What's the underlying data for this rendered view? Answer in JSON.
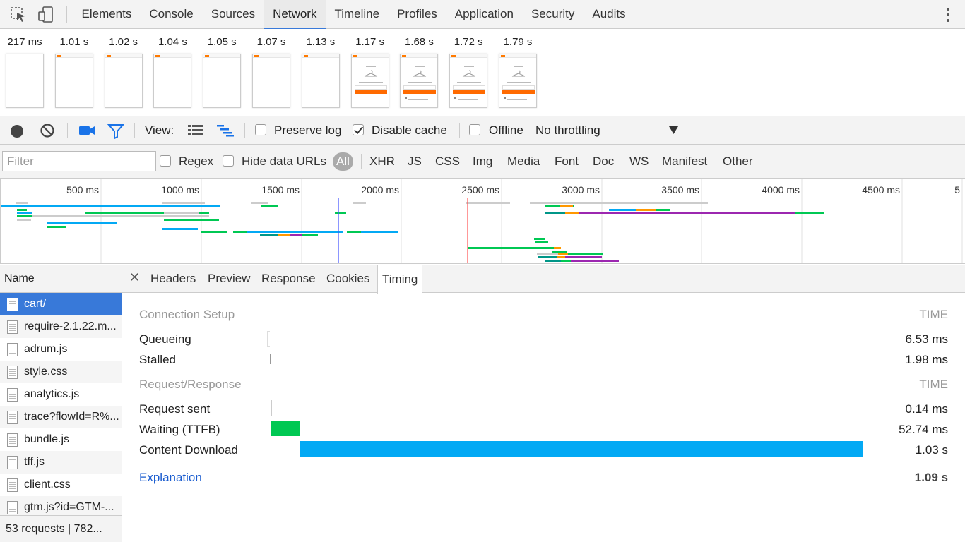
{
  "top_tabs": [
    "Elements",
    "Console",
    "Sources",
    "Network",
    "Timeline",
    "Profiles",
    "Application",
    "Security",
    "Audits"
  ],
  "active_tab": "Network",
  "filmstrip": {
    "frames": [
      {
        "time": "217 ms",
        "content": "blank"
      },
      {
        "time": "1.01 s",
        "content": "header"
      },
      {
        "time": "1.02 s",
        "content": "header"
      },
      {
        "time": "1.04 s",
        "content": "header"
      },
      {
        "time": "1.05 s",
        "content": "header"
      },
      {
        "time": "1.07 s",
        "content": "header"
      },
      {
        "time": "1.13 s",
        "content": "header"
      },
      {
        "time": "1.17 s",
        "content": "cart"
      },
      {
        "time": "1.68 s",
        "content": "cart-full"
      },
      {
        "time": "1.72 s",
        "content": "cart-full"
      },
      {
        "time": "1.79 s",
        "content": "cart-full"
      }
    ]
  },
  "toolbar": {
    "view_label": "View:",
    "preserve_log_label": "Preserve log",
    "preserve_log_checked": false,
    "disable_cache_label": "Disable cache",
    "disable_cache_checked": true,
    "offline_label": "Offline",
    "offline_checked": false,
    "throttling_value": "No throttling"
  },
  "filterbar": {
    "filter_placeholder": "Filter",
    "regex_label": "Regex",
    "hide_data_urls_label": "Hide data URLs",
    "types": [
      "All",
      "XHR",
      "JS",
      "CSS",
      "Img",
      "Media",
      "Font",
      "Doc",
      "WS",
      "Manifest",
      "Other"
    ],
    "active_type": "All"
  },
  "overview": {
    "ticks": [
      "500 ms",
      "1000 ms",
      "1500 ms",
      "2000 ms",
      "2500 ms",
      "3000 ms",
      "3500 ms",
      "4000 ms",
      "4500 ms",
      "5"
    ],
    "colors": {
      "waiting": "#00c853",
      "download": "#03a9f4",
      "queue": "#cccccc",
      "orange": "#ff9800",
      "purple": "#9c27b0",
      "teal": "#009688",
      "dom_line": "#3f51ff",
      "load_line": "#ff5252"
    }
  },
  "requests": {
    "header": "Name",
    "items": [
      "cart/",
      "require-2.1.22.m...",
      "adrum.js",
      "style.css",
      "analytics.js",
      "trace?flowId=R%...",
      "bundle.js",
      "tff.js",
      "client.css",
      "gtm.js?id=GTM-..."
    ],
    "selected_index": 0,
    "summary": "53 requests  |  782..."
  },
  "detail": {
    "tabs": [
      "Headers",
      "Preview",
      "Response",
      "Cookies",
      "Timing"
    ],
    "active_tab": "Timing",
    "sections": [
      {
        "title": "Connection Setup",
        "time_header": "TIME",
        "rows": [
          {
            "label": "Queueing",
            "value": "6.53 ms"
          },
          {
            "label": "Stalled",
            "value": "1.98 ms"
          }
        ]
      },
      {
        "title": "Request/Response",
        "time_header": "TIME",
        "rows": [
          {
            "label": "Request sent",
            "value": "0.14 ms"
          },
          {
            "label": "Waiting (TTFB)",
            "value": "52.74 ms"
          },
          {
            "label": "Content Download",
            "value": "1.03 s"
          }
        ]
      }
    ],
    "explanation_label": "Explanation",
    "total": "1.09 s",
    "bar_colors": {
      "waiting": "#00c853",
      "download": "#03a9f4"
    }
  }
}
